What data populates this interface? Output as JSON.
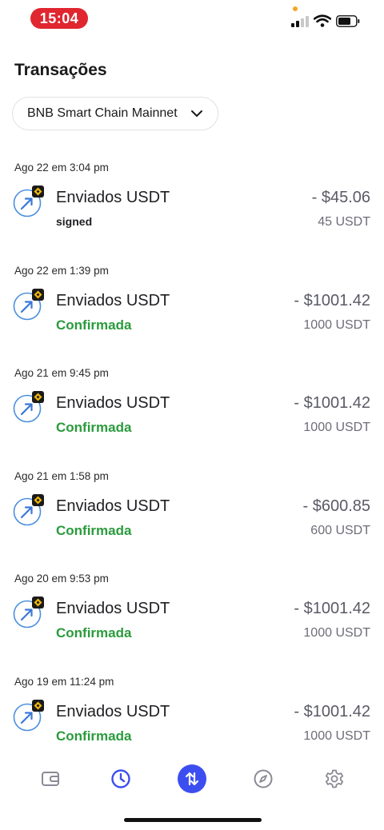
{
  "status_bar": {
    "time": "15:04"
  },
  "page": {
    "title": "Transações"
  },
  "network_select": {
    "selected": "BNB Smart Chain Mainnet"
  },
  "transactions": [
    {
      "date": "Ago 22 em 3:04 pm",
      "title": "Enviados USDT",
      "status": "signed",
      "fiat": "- $45.06",
      "crypto": "45 USDT"
    },
    {
      "date": "Ago 22 em 1:39 pm",
      "title": "Enviados USDT",
      "status": "Confirmada",
      "fiat": "- $1001.42",
      "crypto": "1000 USDT"
    },
    {
      "date": "Ago 21 em 9:45 pm",
      "title": "Enviados USDT",
      "status": "Confirmada",
      "fiat": "- $1001.42",
      "crypto": "1000 USDT"
    },
    {
      "date": "Ago 21 em 1:58 pm",
      "title": "Enviados USDT",
      "status": "Confirmada",
      "fiat": "- $600.85",
      "crypto": "600 USDT"
    },
    {
      "date": "Ago 20 em 9:53 pm",
      "title": "Enviados USDT",
      "status": "Confirmada",
      "fiat": "- $1001.42",
      "crypto": "1000 USDT"
    },
    {
      "date": "Ago 19 em 11:24 pm",
      "title": "Enviados USDT",
      "status": "Confirmada",
      "fiat": "- $1001.42",
      "crypto": "1000 USDT"
    }
  ],
  "colors": {
    "confirmed": "#2a9b3c",
    "accent": "#3c4ef0",
    "time_pill": "#e0262f",
    "bnb_badge": "#f0b90b"
  },
  "bottom_nav": [
    {
      "icon": "wallet-icon",
      "active": false
    },
    {
      "icon": "clock-icon",
      "active": false
    },
    {
      "icon": "swap-arrows-icon",
      "active": true
    },
    {
      "icon": "compass-icon",
      "active": false
    },
    {
      "icon": "gear-icon",
      "active": false
    }
  ]
}
